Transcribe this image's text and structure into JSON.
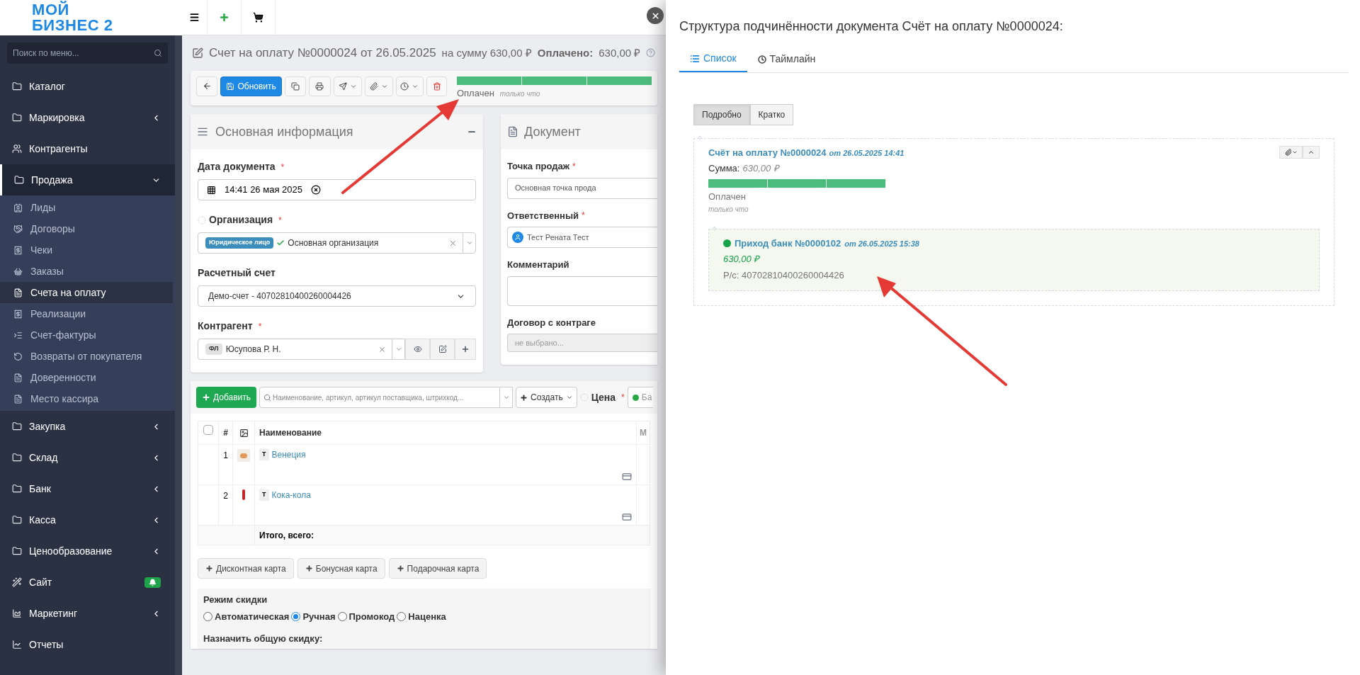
{
  "logo": {
    "line_1": "МОЙ",
    "line_2": "БИЗНЕС 2"
  },
  "sidebar": {
    "search_placeholder": "Поиск по меню...",
    "items": [
      {
        "label": "Каталог",
        "selected": false
      },
      {
        "label": "Маркировка",
        "selected": false,
        "expanded": false
      },
      {
        "label": "Контрагенты",
        "selected": false
      },
      {
        "label": "Продажа",
        "selected": true,
        "expanded": true,
        "children": [
          {
            "label": "Лиды",
            "selected": false
          },
          {
            "label": "Договоры",
            "selected": false
          },
          {
            "label": "Чеки",
            "selected": false
          },
          {
            "label": "Заказы",
            "selected": false
          },
          {
            "label": "Счета на оплату",
            "selected": true
          },
          {
            "label": "Реализации",
            "selected": false
          },
          {
            "label": "Счет-фактуры",
            "selected": false
          },
          {
            "label": "Возвраты от покупателя",
            "selected": false
          },
          {
            "label": "Доверенности",
            "selected": false
          },
          {
            "label": "Место кассира",
            "selected": false
          }
        ]
      },
      {
        "label": "Закупка",
        "selected": false,
        "expanded": false
      },
      {
        "label": "Склад",
        "selected": false,
        "expanded": false
      },
      {
        "label": "Банк",
        "selected": false,
        "expanded": false
      },
      {
        "label": "Касса",
        "selected": false,
        "expanded": false
      },
      {
        "label": "Ценообразование",
        "selected": false,
        "expanded": false
      },
      {
        "label": "Сайт",
        "selected": false,
        "badge": true
      },
      {
        "label": "Маркетинг",
        "selected": false,
        "expanded": false
      },
      {
        "label": "Отчеты",
        "selected": false
      }
    ]
  },
  "page_title": {
    "title": "Счет на оплату №0000024 от 26.05.2025",
    "sum": "на сумму 630,00 ₽",
    "paid_label": "Оплачено:",
    "paid": "630,00 ₽"
  },
  "toolbar": {
    "update_button": "Обновить",
    "status": {
      "level": 1,
      "label": "Оплачен",
      "time": "только что"
    }
  },
  "main_info": {
    "title": "Основная информация",
    "fields": [
      {
        "kind": "datetime",
        "label": "Дата документа",
        "mark": "*",
        "value": "14:41 26 мая 2025"
      },
      {
        "kind": "select2",
        "label": "Организация",
        "mark": "*",
        "tag": "Юридическое лицо",
        "value": "Основная организация",
        "verified": true
      },
      {
        "kind": "select",
        "label": "Расчетный счет",
        "value": "Демо-счет - 40702810400260004426"
      },
      {
        "kind": "select2-actions",
        "label": "Контрагент",
        "mark": "*",
        "tag": "ФЛ",
        "value": "Юсупова Р. Н."
      }
    ]
  },
  "document": {
    "title": "Документ",
    "fields": [
      {
        "kind": "text",
        "label": "Точка продаж",
        "mark": "*",
        "value": "Основная точка прода"
      },
      {
        "kind": "user",
        "label": "Ответственный",
        "mark": "*",
        "value": "Тест Рената Тест"
      },
      {
        "kind": "textarea",
        "label": "Комментарий"
      },
      {
        "kind": "placeholder",
        "label": "Договор с контраге",
        "placeholder": "не выбрано..."
      }
    ]
  },
  "products": {
    "add_button": "Добавить",
    "search_placeholder": "Наименование, артикул, артикул поставщика, штрихкод...",
    "create_button": "Создать",
    "price_label": "Цена",
    "price_mark": "*",
    "price_value": "Ба",
    "select_all_checked": false,
    "columns": [
      "#",
      "Наименование",
      "М"
    ],
    "rows": [
      {
        "number": "1",
        "type": "Т",
        "name": "Венеция"
      },
      {
        "number": "2",
        "type": "Т",
        "name": "Кока-кола"
      }
    ],
    "total_label": "Итого, всего:",
    "card_buttons": [
      "Дисконтная карта",
      "Бонусная карта",
      "Подарочная карта"
    ],
    "discount": {
      "title": "Режим скидки",
      "modes": [
        {
          "label": "Автоматическая",
          "selected": false
        },
        {
          "label": "Ручная",
          "selected": true
        },
        {
          "label": "Промокод",
          "selected": false
        },
        {
          "label": "Наценка",
          "selected": false
        }
      ],
      "assign_label": "Назначить общую скидку:"
    }
  },
  "structure_panel": {
    "title": "Структура подчинённости документа Счёт на оплату №0000024:",
    "tabs": [
      {
        "label": "Список",
        "selected": true
      },
      {
        "label": "Таймлайн",
        "selected": false
      }
    ],
    "view_modes": [
      {
        "label": "Подробно",
        "selected": true
      },
      {
        "label": "Кратко",
        "selected": false
      }
    ],
    "tree": [
      {
        "kind": "invoice",
        "title": "Счёт на оплату №0000024",
        "date": "от 26.05.2025 14:41",
        "sum_label": "Сумма:",
        "sum": "630,00 ₽",
        "level": 1,
        "status": "Оплачен",
        "time": "только что",
        "children": [
          {
            "kind": "payment",
            "color": "#16a34a",
            "title": "Приход банк №0000102",
            "date": "от 26.05.2025 15:38",
            "amount": "630,00 ₽",
            "account": "Р/с: 40702810400260004426"
          }
        ]
      }
    ]
  }
}
